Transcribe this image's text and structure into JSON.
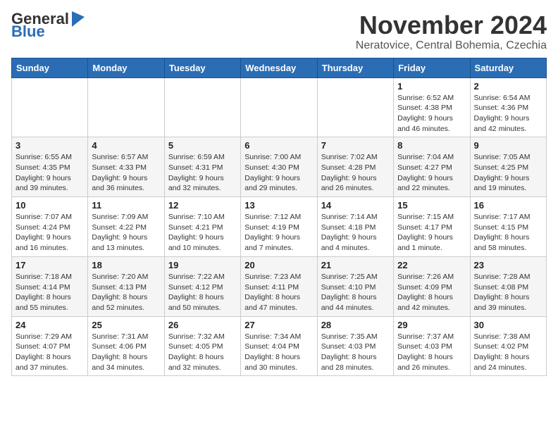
{
  "logo": {
    "general": "General",
    "blue": "Blue"
  },
  "title": {
    "month": "November 2024",
    "location": "Neratovice, Central Bohemia, Czechia"
  },
  "weekdays": [
    "Sunday",
    "Monday",
    "Tuesday",
    "Wednesday",
    "Thursday",
    "Friday",
    "Saturday"
  ],
  "weeks": [
    [
      {
        "day": "",
        "info": ""
      },
      {
        "day": "",
        "info": ""
      },
      {
        "day": "",
        "info": ""
      },
      {
        "day": "",
        "info": ""
      },
      {
        "day": "",
        "info": ""
      },
      {
        "day": "1",
        "info": "Sunrise: 6:52 AM\nSunset: 4:38 PM\nDaylight: 9 hours and 46 minutes."
      },
      {
        "day": "2",
        "info": "Sunrise: 6:54 AM\nSunset: 4:36 PM\nDaylight: 9 hours and 42 minutes."
      }
    ],
    [
      {
        "day": "3",
        "info": "Sunrise: 6:55 AM\nSunset: 4:35 PM\nDaylight: 9 hours and 39 minutes."
      },
      {
        "day": "4",
        "info": "Sunrise: 6:57 AM\nSunset: 4:33 PM\nDaylight: 9 hours and 36 minutes."
      },
      {
        "day": "5",
        "info": "Sunrise: 6:59 AM\nSunset: 4:31 PM\nDaylight: 9 hours and 32 minutes."
      },
      {
        "day": "6",
        "info": "Sunrise: 7:00 AM\nSunset: 4:30 PM\nDaylight: 9 hours and 29 minutes."
      },
      {
        "day": "7",
        "info": "Sunrise: 7:02 AM\nSunset: 4:28 PM\nDaylight: 9 hours and 26 minutes."
      },
      {
        "day": "8",
        "info": "Sunrise: 7:04 AM\nSunset: 4:27 PM\nDaylight: 9 hours and 22 minutes."
      },
      {
        "day": "9",
        "info": "Sunrise: 7:05 AM\nSunset: 4:25 PM\nDaylight: 9 hours and 19 minutes."
      }
    ],
    [
      {
        "day": "10",
        "info": "Sunrise: 7:07 AM\nSunset: 4:24 PM\nDaylight: 9 hours and 16 minutes."
      },
      {
        "day": "11",
        "info": "Sunrise: 7:09 AM\nSunset: 4:22 PM\nDaylight: 9 hours and 13 minutes."
      },
      {
        "day": "12",
        "info": "Sunrise: 7:10 AM\nSunset: 4:21 PM\nDaylight: 9 hours and 10 minutes."
      },
      {
        "day": "13",
        "info": "Sunrise: 7:12 AM\nSunset: 4:19 PM\nDaylight: 9 hours and 7 minutes."
      },
      {
        "day": "14",
        "info": "Sunrise: 7:14 AM\nSunset: 4:18 PM\nDaylight: 9 hours and 4 minutes."
      },
      {
        "day": "15",
        "info": "Sunrise: 7:15 AM\nSunset: 4:17 PM\nDaylight: 9 hours and 1 minute."
      },
      {
        "day": "16",
        "info": "Sunrise: 7:17 AM\nSunset: 4:15 PM\nDaylight: 8 hours and 58 minutes."
      }
    ],
    [
      {
        "day": "17",
        "info": "Sunrise: 7:18 AM\nSunset: 4:14 PM\nDaylight: 8 hours and 55 minutes."
      },
      {
        "day": "18",
        "info": "Sunrise: 7:20 AM\nSunset: 4:13 PM\nDaylight: 8 hours and 52 minutes."
      },
      {
        "day": "19",
        "info": "Sunrise: 7:22 AM\nSunset: 4:12 PM\nDaylight: 8 hours and 50 minutes."
      },
      {
        "day": "20",
        "info": "Sunrise: 7:23 AM\nSunset: 4:11 PM\nDaylight: 8 hours and 47 minutes."
      },
      {
        "day": "21",
        "info": "Sunrise: 7:25 AM\nSunset: 4:10 PM\nDaylight: 8 hours and 44 minutes."
      },
      {
        "day": "22",
        "info": "Sunrise: 7:26 AM\nSunset: 4:09 PM\nDaylight: 8 hours and 42 minutes."
      },
      {
        "day": "23",
        "info": "Sunrise: 7:28 AM\nSunset: 4:08 PM\nDaylight: 8 hours and 39 minutes."
      }
    ],
    [
      {
        "day": "24",
        "info": "Sunrise: 7:29 AM\nSunset: 4:07 PM\nDaylight: 8 hours and 37 minutes."
      },
      {
        "day": "25",
        "info": "Sunrise: 7:31 AM\nSunset: 4:06 PM\nDaylight: 8 hours and 34 minutes."
      },
      {
        "day": "26",
        "info": "Sunrise: 7:32 AM\nSunset: 4:05 PM\nDaylight: 8 hours and 32 minutes."
      },
      {
        "day": "27",
        "info": "Sunrise: 7:34 AM\nSunset: 4:04 PM\nDaylight: 8 hours and 30 minutes."
      },
      {
        "day": "28",
        "info": "Sunrise: 7:35 AM\nSunset: 4:03 PM\nDaylight: 8 hours and 28 minutes."
      },
      {
        "day": "29",
        "info": "Sunrise: 7:37 AM\nSunset: 4:03 PM\nDaylight: 8 hours and 26 minutes."
      },
      {
        "day": "30",
        "info": "Sunrise: 7:38 AM\nSunset: 4:02 PM\nDaylight: 8 hours and 24 minutes."
      }
    ]
  ]
}
